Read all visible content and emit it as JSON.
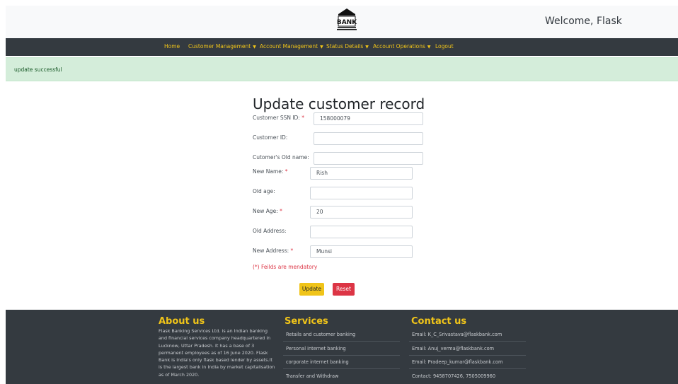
{
  "header": {
    "logo_text": "BANK",
    "welcome": "Welcome, Flask"
  },
  "nav": {
    "items": [
      {
        "label": "Home",
        "dropdown": false
      },
      {
        "label": "Customer Management",
        "dropdown": true
      },
      {
        "label": "Account Management",
        "dropdown": true
      },
      {
        "label": "Status Details",
        "dropdown": true
      },
      {
        "label": "Account Operations",
        "dropdown": true
      },
      {
        "label": "Logout",
        "dropdown": false
      }
    ]
  },
  "alert": {
    "message": "update successful"
  },
  "form": {
    "title": "Update customer record",
    "fields": [
      {
        "label": "Customer SSN ID:",
        "required": true,
        "value": "158000079"
      },
      {
        "label": "Customer ID:",
        "required": false,
        "value": ""
      },
      {
        "label": "Cutomer's Old name:",
        "required": false,
        "value": ""
      },
      {
        "label": "New Name:",
        "required": true,
        "value": "Rish"
      },
      {
        "label": "Old age:",
        "required": false,
        "value": ""
      },
      {
        "label": "New Age:",
        "required": true,
        "value": "20"
      },
      {
        "label": "Old Address:",
        "required": false,
        "value": ""
      },
      {
        "label": "New Address:",
        "required": true,
        "value": "Munsi"
      }
    ],
    "required_mark": "*",
    "note": "(*) Feilds are mendatory",
    "update_label": "Update",
    "reset_label": "Reset"
  },
  "footer": {
    "about": {
      "heading": "About us",
      "text": "Flask Banking Services Ltd. is an Indian banking and financial services company headquartered in Lucknow, Uttar Pradesh. It has a base of 3 permanent employees as of 16 June 2020. Flask Bank is India's only flask based lender by assets.It is the largest bank in India by market capitalisation as of March 2020."
    },
    "services": {
      "heading": "Services",
      "items": [
        "Retails and customer banking",
        "Personal internet banking",
        "corporate internet banking",
        "Transfer and Withdraw"
      ]
    },
    "contact": {
      "heading": "Contact us",
      "items": [
        "Email: K_C_Srivastava@flaskbank.com",
        "Email: Anuj_verma@flaskbank.com",
        "Email: Pradeep_kumar@flaskbank.com",
        "Contact: 9458707426, 7505009960"
      ]
    }
  },
  "colors": {
    "accent": "#f0c419",
    "nav_bg": "#343a40",
    "success_bg": "#d4edda",
    "danger": "#dc3545"
  }
}
